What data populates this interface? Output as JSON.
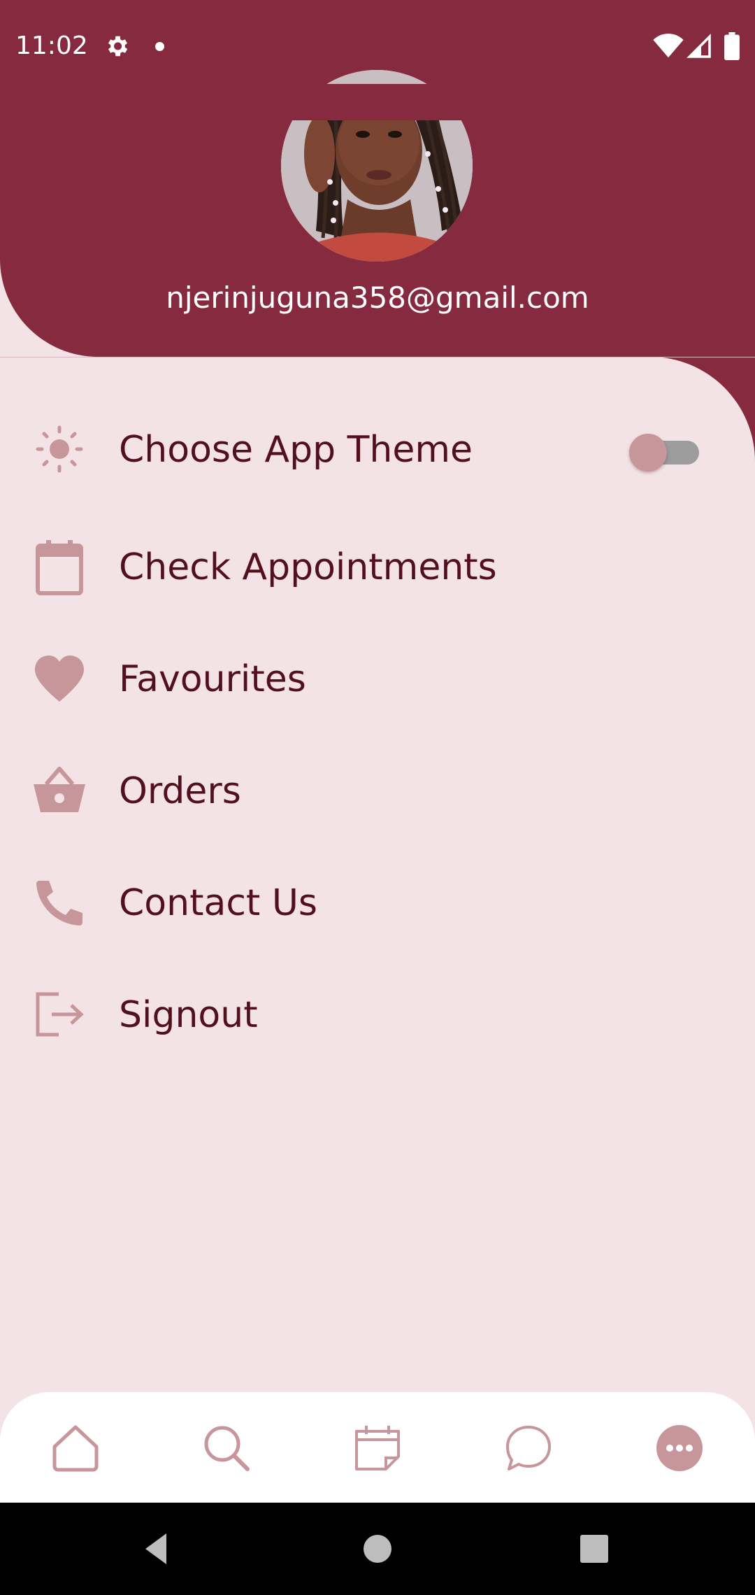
{
  "status_bar": {
    "time": "11:02",
    "icons": [
      "settings-icon",
      "notification-dot",
      "wifi-icon",
      "signal-icon",
      "battery-icon"
    ]
  },
  "profile": {
    "email": "njerinjuguna358@gmail.com",
    "avatar": "profile-photo"
  },
  "menu": {
    "items": [
      {
        "label": "Choose App Theme",
        "icon": "sun-icon",
        "has_toggle": true,
        "toggle_on": false
      },
      {
        "label": "Check Appointments",
        "icon": "calendar-icon"
      },
      {
        "label": "Favourites",
        "icon": "heart-icon"
      },
      {
        "label": "Orders",
        "icon": "basket-icon"
      },
      {
        "label": "Contact Us",
        "icon": "phone-icon"
      },
      {
        "label": "Signout",
        "icon": "signout-icon"
      }
    ]
  },
  "bottom_nav": {
    "items": [
      "home-icon",
      "search-icon",
      "calendar-note-icon",
      "chat-icon",
      "more-icon"
    ],
    "active_index": 4
  },
  "colors": {
    "header": "#862a40",
    "background": "#f4e3e6",
    "menu_text": "#52101f",
    "icon_accent": "#c7969b",
    "nav_bar": "#ffffff"
  }
}
